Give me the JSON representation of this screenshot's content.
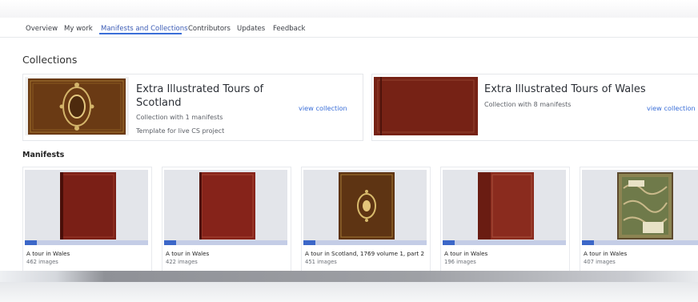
{
  "nav": {
    "tabs": [
      "Overview",
      "My work",
      "Manifests and Collections",
      "Contributors",
      "Updates",
      "Feedback"
    ],
    "active": "Manifests and Collections"
  },
  "collections": {
    "heading": "Collections",
    "items": [
      {
        "title_line1": "Extra Illustrated Tours of",
        "title_line2": "Scotland",
        "meta": "Collection with 1 manifests",
        "note": "Template for live CS project",
        "link": "view collection"
      },
      {
        "title_line1": "Extra Illustrated Tours of Wales",
        "meta": "Collection with 8 manifests",
        "link": "view collection"
      }
    ]
  },
  "manifests": {
    "heading": "Manifests",
    "items": [
      {
        "title": "A tour in Wales",
        "count": "462 images",
        "progress": 0.1
      },
      {
        "title": "A tour in Wales",
        "count": "422 images",
        "progress": 0.1
      },
      {
        "title": "A tour in Scotland, 1769 volume 1, part 2",
        "count": "451 images",
        "progress": 0.1
      },
      {
        "title": "A tour in Wales",
        "count": "196 images",
        "progress": 0.1
      },
      {
        "title": "A tour in Wales",
        "count": "407 images",
        "progress": 0.1
      }
    ]
  },
  "colors": {
    "accent": "#3b6fd8",
    "progress_bg": "#c4cde6",
    "progress_fill": "#3c67c8"
  }
}
